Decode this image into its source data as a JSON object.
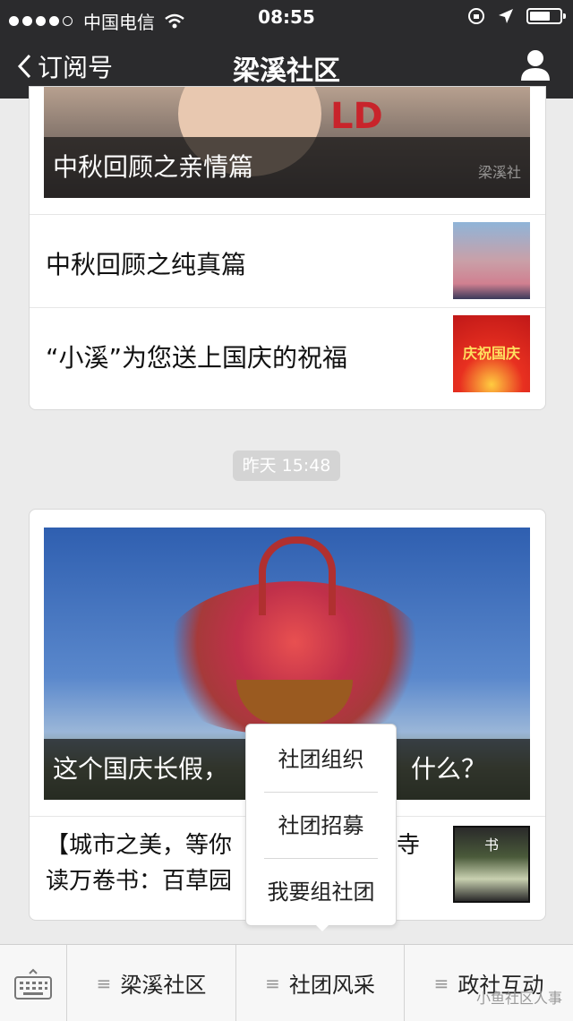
{
  "status_bar": {
    "carrier": "中国电信",
    "time": "08:55"
  },
  "nav": {
    "back_label": "订阅号",
    "title": "梁溪社区"
  },
  "card1": {
    "hero_caption": "中秋回顾之亲情篇",
    "hero_watermark": "梁溪社",
    "items": [
      {
        "label": "中秋回顾之纯真篇"
      },
      {
        "label": "“小溪”为您送上国庆的祝福"
      }
    ],
    "thumb2_text": "庆祝国庆"
  },
  "timestamp": "昨天 15:48",
  "card2": {
    "hero_caption_left": "这个国庆长假，",
    "hero_caption_right": "什么？",
    "article_line1": "【城市之美，等你",
    "article_line1_end": "寺",
    "article_line2": "读万卷书：百草园",
    "thumb_text": "书"
  },
  "popup": {
    "items": [
      "社团组织",
      "社团招募",
      "我要组社团"
    ]
  },
  "bottom_menu": {
    "items": [
      "梁溪社区",
      "社团风采",
      "政社互动"
    ]
  },
  "watermark": "小鱼社区人事"
}
